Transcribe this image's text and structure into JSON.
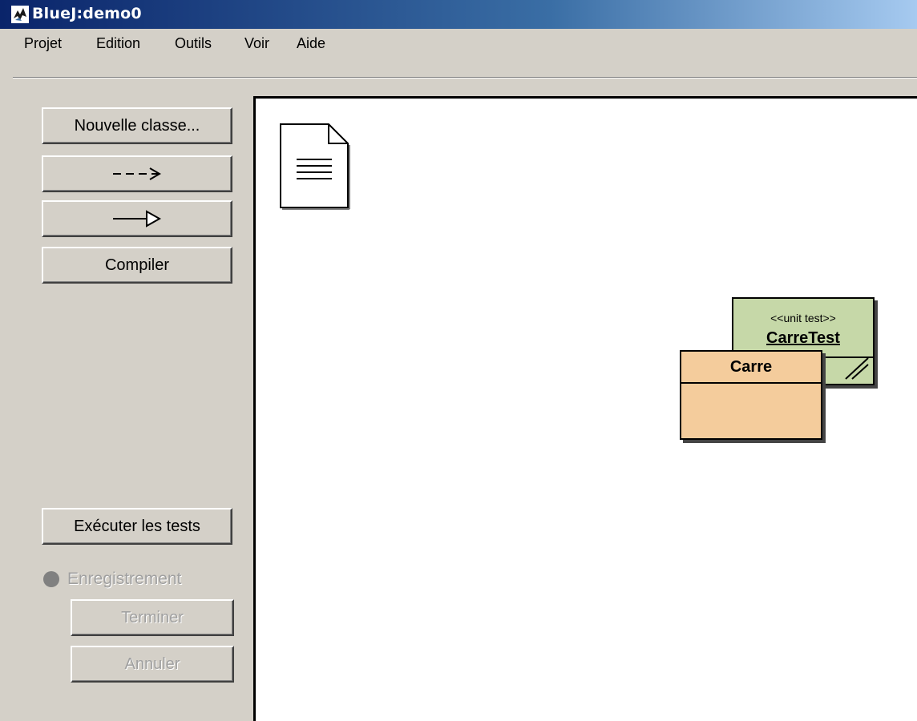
{
  "window": {
    "title": "BlueJ:demo0"
  },
  "menu": {
    "items": [
      "Projet",
      "Edition",
      "Outils",
      "Voir",
      "Aide"
    ]
  },
  "sidebar": {
    "new_class": "Nouvelle classe...",
    "uses_arrow_icon": "dashed-arrow-icon",
    "inherits_arrow_icon": "inheritance-arrow-icon",
    "compile": "Compiler",
    "run_tests": "Exécuter les tests",
    "recording": "Enregistrement",
    "finish": "Terminer",
    "cancel": "Annuler"
  },
  "diagram": {
    "readme_icon": "document-icon",
    "classes": [
      {
        "name": "CarreTest",
        "stereotype": "<<unit test>>",
        "color": "#c6d8a8"
      },
      {
        "name": "Carre",
        "stereotype": "",
        "color": "#f4cc9c"
      }
    ]
  },
  "colors": {
    "titlebar_start": "#0a246a",
    "titlebar_end": "#a6caf0",
    "panel": "#d4d0c8"
  }
}
